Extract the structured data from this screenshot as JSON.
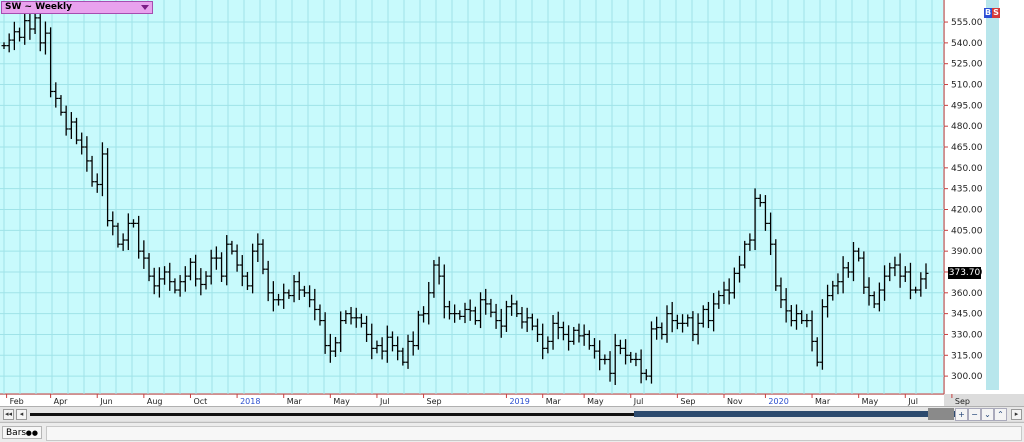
{
  "header": {
    "symbol_label": "SW ~ Weekly",
    "bs_b": "B",
    "bs_s": "S"
  },
  "last_price": "373.70",
  "bottom": {
    "bars_tab": "Bars",
    "bars_icon": "glasses-icon"
  },
  "colors": {
    "plot_bg": "#c8fafc",
    "grid": "#9fe3e8",
    "bars": "#000000",
    "right_axis": "#c84040",
    "year_label": "#2b4fd0"
  },
  "chart_data": {
    "type": "bar",
    "subtype": "OHLC price bars",
    "ylim": [
      290,
      568
    ],
    "yticks": [
      "555.00",
      "540.00",
      "525.00",
      "510.00",
      "495.00",
      "480.00",
      "465.00",
      "450.00",
      "435.00",
      "420.00",
      "405.00",
      "390.00",
      "375.00",
      "360.00",
      "345.00",
      "330.00",
      "315.00",
      "300.00"
    ],
    "xticks": [
      {
        "label": "Feb",
        "x": 0.5
      },
      {
        "label": "Apr",
        "x": 9
      },
      {
        "label": "Jun",
        "x": 18
      },
      {
        "label": "Aug",
        "x": 27
      },
      {
        "label": "Oct",
        "x": 36
      },
      {
        "label": "2018",
        "x": 45,
        "year": true
      },
      {
        "label": "Mar",
        "x": 54
      },
      {
        "label": "May",
        "x": 63
      },
      {
        "label": "Jul",
        "x": 72
      },
      {
        "label": "Sep",
        "x": 81
      },
      {
        "label": "2019",
        "x": 97,
        "year": true
      },
      {
        "label": "Mar",
        "x": 104
      },
      {
        "label": "May",
        "x": 112
      },
      {
        "label": "Jul",
        "x": 121
      },
      {
        "label": "Sep",
        "x": 130
      },
      {
        "label": "Nov",
        "x": 139
      },
      {
        "label": "2020",
        "x": 147,
        "year": true
      },
      {
        "label": "Mar",
        "x": 156
      },
      {
        "label": "May",
        "x": 165
      },
      {
        "label": "Jul",
        "x": 174
      },
      {
        "label": "Sep",
        "x": 183
      }
    ],
    "grid": true,
    "closes": [
      538,
      542,
      548,
      544,
      556,
      550,
      558,
      540,
      547,
      505,
      500,
      490,
      478,
      483,
      470,
      465,
      455,
      440,
      438,
      460,
      412,
      408,
      395,
      398,
      410,
      410,
      390,
      385,
      372,
      365,
      370,
      375,
      368,
      362,
      368,
      372,
      382,
      370,
      366,
      372,
      385,
      385,
      372,
      395,
      390,
      380,
      372,
      365,
      390,
      395,
      377,
      360,
      355,
      355,
      360,
      358,
      368,
      362,
      360,
      355,
      348,
      340,
      322,
      318,
      324,
      340,
      345,
      342,
      342,
      338,
      330,
      320,
      322,
      318,
      328,
      322,
      318,
      310,
      325,
      322,
      344,
      345,
      360,
      380,
      372,
      350,
      345,
      345,
      343,
      348,
      347,
      340,
      355,
      352,
      346,
      340,
      336,
      350,
      352,
      345,
      339,
      342,
      336,
      330,
      320,
      325,
      338,
      335,
      330,
      325,
      333,
      329,
      330,
      322,
      318,
      312,
      312,
      302,
      322,
      320,
      315,
      312,
      312,
      302,
      300,
      334,
      335,
      330,
      345,
      340,
      338,
      338,
      342,
      330,
      338,
      348,
      340,
      352,
      358,
      362,
      360,
      374,
      380,
      395,
      398,
      428,
      425,
      410,
      395,
      365,
      355,
      347,
      340,
      345,
      340,
      340,
      325,
      310,
      350,
      358,
      365,
      368,
      378,
      375,
      390,
      385,
      364,
      358,
      352,
      362,
      372,
      378,
      380,
      372,
      375,
      362,
      362,
      370,
      374
    ]
  }
}
